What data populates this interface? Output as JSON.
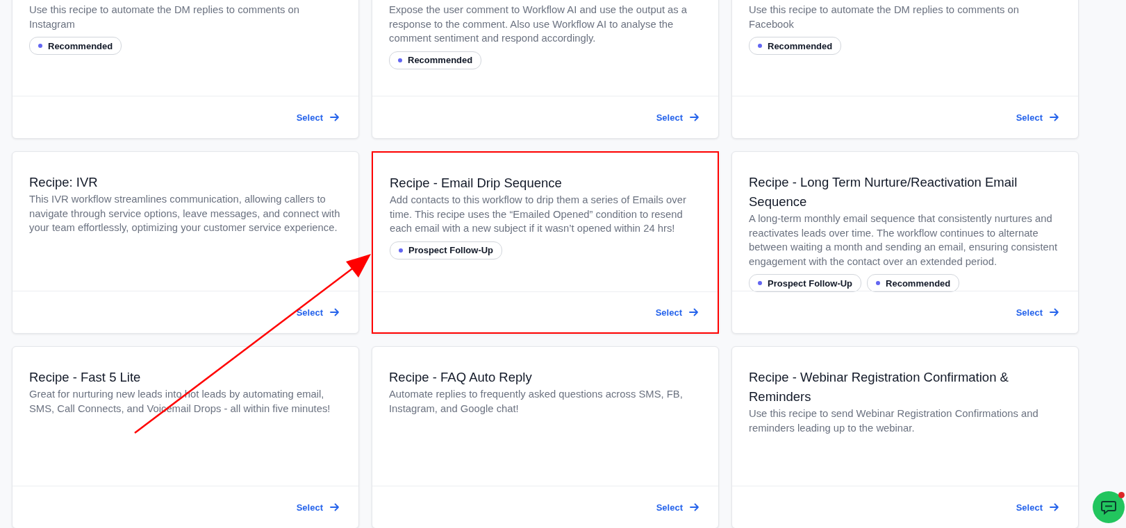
{
  "rows": [
    {
      "cards": [
        {
          "description": "Use this recipe to automate the DM replies to comments on Instagram",
          "tags": [
            "Recommended"
          ],
          "action": "Select",
          "highlighted": false
        },
        {
          "description": "Expose the user comment to Workflow AI and use the output as a response to the comment. Also use Workflow AI to analyse the comment sentiment and respond accordingly.",
          "tags": [
            "Recommended"
          ],
          "action": "Select",
          "highlighted": false
        },
        {
          "description": "Use this recipe to automate the DM replies to comments on Facebook",
          "tags": [
            "Recommended"
          ],
          "action": "Select",
          "highlighted": false
        }
      ]
    },
    {
      "cards": [
        {
          "title": "Recipe: IVR",
          "description": "This IVR workflow streamlines communication, allowing callers to navigate through service options, leave messages, and connect with your team effortlessly, optimizing your customer service experience.",
          "action": "Select",
          "highlighted": false
        },
        {
          "title": "Recipe - Email Drip Sequence",
          "description": "Add contacts to this workflow to drip them a series of Emails over time. This recipe uses the “Emailed Opened” condition to resend each email with a new subject if it wasn’t opened within 24 hrs!",
          "tags": [
            "Prospect Follow-Up"
          ],
          "action": "Select",
          "highlighted": true
        },
        {
          "title": "Recipe - Long Term Nurture/Reactivation Email Sequence",
          "description": "A long-term monthly email sequence that consistently nurtures and reactivates leads over time. The workflow continues to alternate between waiting a month and sending an email, ensuring consistent engagement with the contact over an extended period.",
          "tags": [
            "Prospect Follow-Up",
            "Recommended"
          ],
          "action": "Select",
          "highlighted": false
        }
      ]
    },
    {
      "cards": [
        {
          "title": "Recipe - Fast 5 Lite",
          "description": "Great for nurturing new leads into hot leads by automating email, SMS, Call Connects, and Voicemail Drops - all within five minutes!",
          "action": "Select",
          "highlighted": false
        },
        {
          "title": "Recipe - FAQ Auto Reply",
          "description": "Automate replies to frequently asked questions across SMS, FB, Instagram, and Google chat!",
          "action": "Select",
          "highlighted": false
        },
        {
          "title": "Recipe - Webinar Registration Confirmation & Reminders",
          "description": "Use this recipe to send Webinar Registration Confirmations and reminders leading up to the webinar.",
          "action": "Select",
          "highlighted": false
        }
      ]
    }
  ]
}
